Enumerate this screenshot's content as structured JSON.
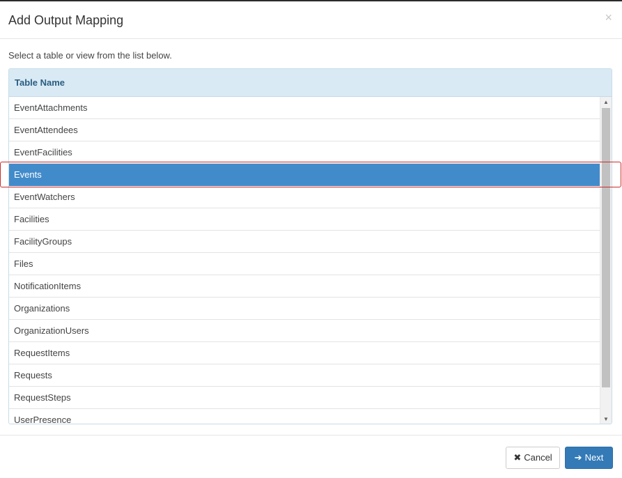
{
  "dialog": {
    "title": "Add Output Mapping",
    "close_glyph": "×",
    "instruction": "Select a table or view from the list below."
  },
  "table": {
    "header": "Table Name",
    "selected_index": 3,
    "rows": [
      "EventAttachments",
      "EventAttendees",
      "EventFacilities",
      "Events",
      "EventWatchers",
      "Facilities",
      "FacilityGroups",
      "Files",
      "NotificationItems",
      "Organizations",
      "OrganizationUsers",
      "RequestItems",
      "Requests",
      "RequestSteps",
      "UserPresence"
    ]
  },
  "footer": {
    "cancel_label": "Cancel",
    "cancel_icon": "close-icon",
    "next_label": "Next",
    "next_icon": "arrow-right-icon"
  },
  "colors": {
    "selected_row": "#428bca",
    "header_bg": "#d9eaf5",
    "primary_button": "#337ab7",
    "highlight_outline": "#cc2b2b"
  }
}
